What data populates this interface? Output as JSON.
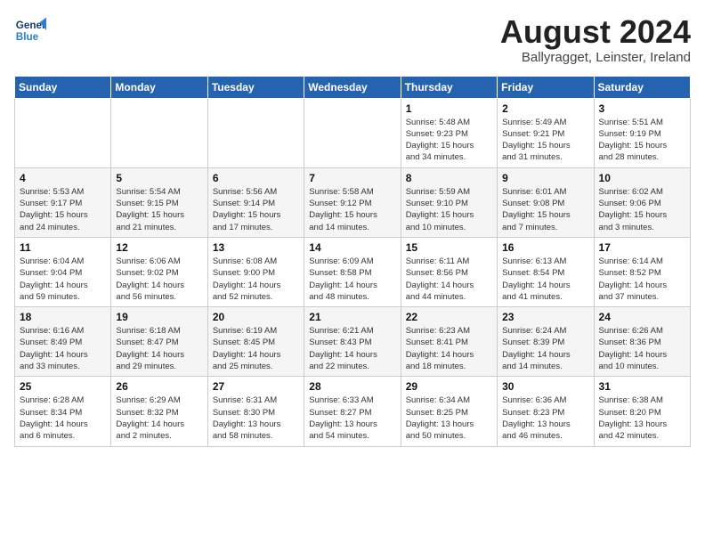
{
  "logo": {
    "line1": "General",
    "line2": "Blue"
  },
  "title": "August 2024",
  "subtitle": "Ballyragget, Leinster, Ireland",
  "weekdays": [
    "Sunday",
    "Monday",
    "Tuesday",
    "Wednesday",
    "Thursday",
    "Friday",
    "Saturday"
  ],
  "weeks": [
    [
      {
        "day": "",
        "info": ""
      },
      {
        "day": "",
        "info": ""
      },
      {
        "day": "",
        "info": ""
      },
      {
        "day": "",
        "info": ""
      },
      {
        "day": "1",
        "info": "Sunrise: 5:48 AM\nSunset: 9:23 PM\nDaylight: 15 hours\nand 34 minutes."
      },
      {
        "day": "2",
        "info": "Sunrise: 5:49 AM\nSunset: 9:21 PM\nDaylight: 15 hours\nand 31 minutes."
      },
      {
        "day": "3",
        "info": "Sunrise: 5:51 AM\nSunset: 9:19 PM\nDaylight: 15 hours\nand 28 minutes."
      }
    ],
    [
      {
        "day": "4",
        "info": "Sunrise: 5:53 AM\nSunset: 9:17 PM\nDaylight: 15 hours\nand 24 minutes."
      },
      {
        "day": "5",
        "info": "Sunrise: 5:54 AM\nSunset: 9:15 PM\nDaylight: 15 hours\nand 21 minutes."
      },
      {
        "day": "6",
        "info": "Sunrise: 5:56 AM\nSunset: 9:14 PM\nDaylight: 15 hours\nand 17 minutes."
      },
      {
        "day": "7",
        "info": "Sunrise: 5:58 AM\nSunset: 9:12 PM\nDaylight: 15 hours\nand 14 minutes."
      },
      {
        "day": "8",
        "info": "Sunrise: 5:59 AM\nSunset: 9:10 PM\nDaylight: 15 hours\nand 10 minutes."
      },
      {
        "day": "9",
        "info": "Sunrise: 6:01 AM\nSunset: 9:08 PM\nDaylight: 15 hours\nand 7 minutes."
      },
      {
        "day": "10",
        "info": "Sunrise: 6:02 AM\nSunset: 9:06 PM\nDaylight: 15 hours\nand 3 minutes."
      }
    ],
    [
      {
        "day": "11",
        "info": "Sunrise: 6:04 AM\nSunset: 9:04 PM\nDaylight: 14 hours\nand 59 minutes."
      },
      {
        "day": "12",
        "info": "Sunrise: 6:06 AM\nSunset: 9:02 PM\nDaylight: 14 hours\nand 56 minutes."
      },
      {
        "day": "13",
        "info": "Sunrise: 6:08 AM\nSunset: 9:00 PM\nDaylight: 14 hours\nand 52 minutes."
      },
      {
        "day": "14",
        "info": "Sunrise: 6:09 AM\nSunset: 8:58 PM\nDaylight: 14 hours\nand 48 minutes."
      },
      {
        "day": "15",
        "info": "Sunrise: 6:11 AM\nSunset: 8:56 PM\nDaylight: 14 hours\nand 44 minutes."
      },
      {
        "day": "16",
        "info": "Sunrise: 6:13 AM\nSunset: 8:54 PM\nDaylight: 14 hours\nand 41 minutes."
      },
      {
        "day": "17",
        "info": "Sunrise: 6:14 AM\nSunset: 8:52 PM\nDaylight: 14 hours\nand 37 minutes."
      }
    ],
    [
      {
        "day": "18",
        "info": "Sunrise: 6:16 AM\nSunset: 8:49 PM\nDaylight: 14 hours\nand 33 minutes."
      },
      {
        "day": "19",
        "info": "Sunrise: 6:18 AM\nSunset: 8:47 PM\nDaylight: 14 hours\nand 29 minutes."
      },
      {
        "day": "20",
        "info": "Sunrise: 6:19 AM\nSunset: 8:45 PM\nDaylight: 14 hours\nand 25 minutes."
      },
      {
        "day": "21",
        "info": "Sunrise: 6:21 AM\nSunset: 8:43 PM\nDaylight: 14 hours\nand 22 minutes."
      },
      {
        "day": "22",
        "info": "Sunrise: 6:23 AM\nSunset: 8:41 PM\nDaylight: 14 hours\nand 18 minutes."
      },
      {
        "day": "23",
        "info": "Sunrise: 6:24 AM\nSunset: 8:39 PM\nDaylight: 14 hours\nand 14 minutes."
      },
      {
        "day": "24",
        "info": "Sunrise: 6:26 AM\nSunset: 8:36 PM\nDaylight: 14 hours\nand 10 minutes."
      }
    ],
    [
      {
        "day": "25",
        "info": "Sunrise: 6:28 AM\nSunset: 8:34 PM\nDaylight: 14 hours\nand 6 minutes."
      },
      {
        "day": "26",
        "info": "Sunrise: 6:29 AM\nSunset: 8:32 PM\nDaylight: 14 hours\nand 2 minutes."
      },
      {
        "day": "27",
        "info": "Sunrise: 6:31 AM\nSunset: 8:30 PM\nDaylight: 13 hours\nand 58 minutes."
      },
      {
        "day": "28",
        "info": "Sunrise: 6:33 AM\nSunset: 8:27 PM\nDaylight: 13 hours\nand 54 minutes."
      },
      {
        "day": "29",
        "info": "Sunrise: 6:34 AM\nSunset: 8:25 PM\nDaylight: 13 hours\nand 50 minutes."
      },
      {
        "day": "30",
        "info": "Sunrise: 6:36 AM\nSunset: 8:23 PM\nDaylight: 13 hours\nand 46 minutes."
      },
      {
        "day": "31",
        "info": "Sunrise: 6:38 AM\nSunset: 8:20 PM\nDaylight: 13 hours\nand 42 minutes."
      }
    ]
  ]
}
